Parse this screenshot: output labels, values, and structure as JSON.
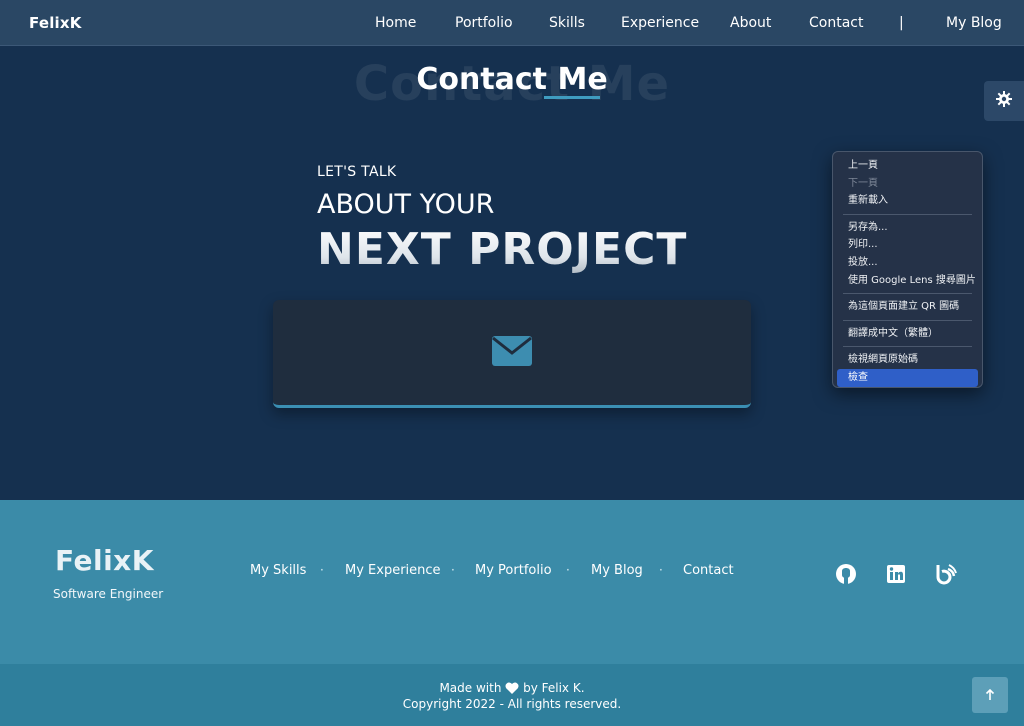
{
  "nav": {
    "brand": "FelixK",
    "links": [
      "Home",
      "Portfolio",
      "Skills",
      "Experience",
      "About",
      "Contact",
      "|",
      "My Blog"
    ]
  },
  "section": {
    "ghost_title": "Contact Me",
    "title": "Contact Me",
    "lets_talk": "LET'S TALK",
    "about_your": "ABOUT YOUR",
    "next_project": "NEXT PROJECT",
    "mail_icon": "envelope-icon"
  },
  "settings_icon": "gear-icon",
  "context_menu": {
    "items": [
      {
        "label": "上一頁",
        "disabled": false
      },
      {
        "label": "下一頁",
        "disabled": true
      },
      {
        "label": "重新載入",
        "disabled": false
      },
      {
        "label": "另存為...",
        "disabled": false
      },
      {
        "label": "列印...",
        "disabled": false
      },
      {
        "label": "投放...",
        "disabled": false
      },
      {
        "label": "使用 Google Lens 搜尋圖片",
        "disabled": false
      },
      {
        "label": "為這個頁面建立 QR 圖碼",
        "disabled": false
      },
      {
        "label": "翻譯成中文（繁體）",
        "disabled": false
      },
      {
        "label": "檢視網頁原始碼",
        "disabled": false
      },
      {
        "label": "檢查",
        "disabled": false,
        "active": true
      }
    ]
  },
  "footer": {
    "brand": "FelixK",
    "subtitle": "Software Engineer",
    "links": [
      "My Skills",
      "My Experience",
      "My Portfolio",
      "My Blog",
      "Contact"
    ],
    "separator": "·",
    "social_icons": [
      "github-icon",
      "linkedin-icon",
      "blog-icon"
    ],
    "made_with_prefix": "Made with",
    "made_with_suffix": "by Felix K.",
    "copyright": "Copyright 2022 - All rights reserved.",
    "scroll_icon": "arrow-up-icon"
  },
  "colors": {
    "background": "#15304f",
    "navbar": "#2a4764",
    "accent": "#3b8fb3",
    "footer": "#3b8ba8",
    "bottom_bar": "#2f7f9c",
    "menu_highlight": "#2f5fc8"
  }
}
